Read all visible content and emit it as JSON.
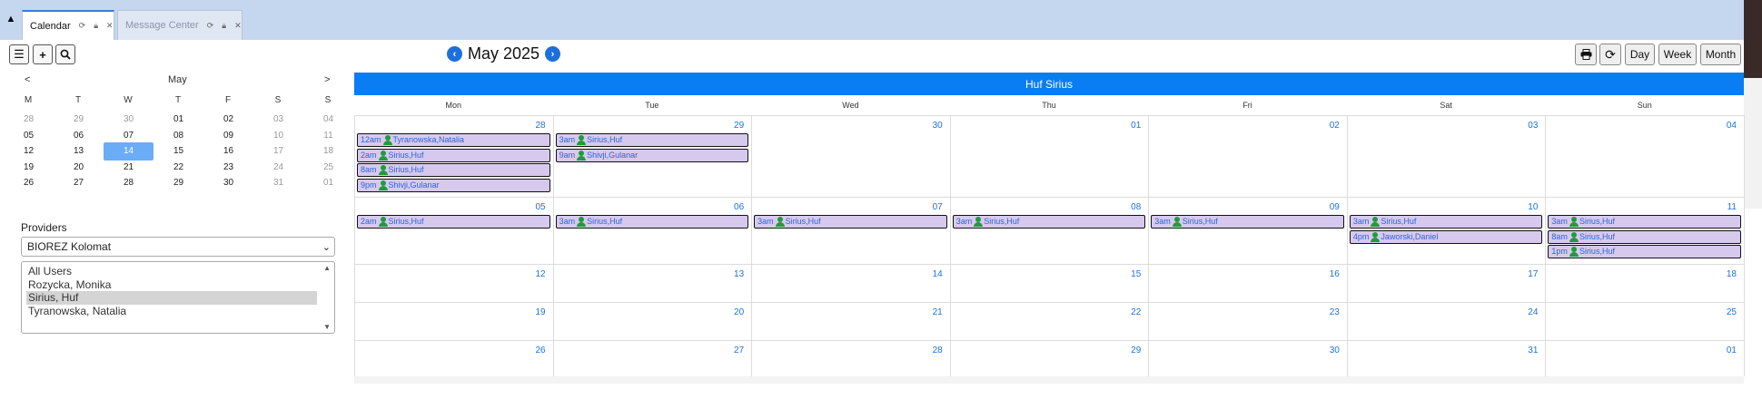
{
  "tabs": [
    {
      "label": "Calendar"
    },
    {
      "label": "Message Center"
    }
  ],
  "toolbar": {
    "menu_icon": "menu-icon",
    "add_icon": "plus-icon",
    "search_icon": "search-icon"
  },
  "mini_calendar": {
    "prev": "<",
    "next": ">",
    "month": "May",
    "weekday_headers": [
      "M",
      "T",
      "W",
      "T",
      "F",
      "S",
      "S"
    ],
    "weeks": [
      [
        "28",
        "29",
        "30",
        "01",
        "02",
        "03",
        "04"
      ],
      [
        "05",
        "06",
        "07",
        "08",
        "09",
        "10",
        "11"
      ],
      [
        "12",
        "13",
        "14",
        "15",
        "16",
        "17",
        "18"
      ],
      [
        "19",
        "20",
        "21",
        "22",
        "23",
        "24",
        "25"
      ],
      [
        "26",
        "27",
        "28",
        "29",
        "30",
        "31",
        "01"
      ]
    ],
    "selected": "14"
  },
  "providers": {
    "label": "Providers",
    "facility_selected": "BIOREZ Kolomat",
    "list": [
      "All Users",
      "Rozycka, Monika",
      "Sirius, Huf",
      "Tyranowska, Natalia"
    ],
    "selected_index": 2
  },
  "header": {
    "title": "May 2025",
    "prev_icon": "chevron-left-icon",
    "next_icon": "chevron-right-icon"
  },
  "view_buttons": {
    "print_icon": "print-icon",
    "refresh_icon": "refresh-icon",
    "day": "Day",
    "week": "Week",
    "month": "Month"
  },
  "calendar": {
    "provider_banner": "Huf Sirius",
    "weekdays": [
      "Mon",
      "Tue",
      "Wed",
      "Thu",
      "Fri",
      "Sat",
      "Sun"
    ],
    "weeks": [
      [
        "28",
        "29",
        "30",
        "01",
        "02",
        "03",
        "04"
      ],
      [
        "05",
        "06",
        "07",
        "08",
        "09",
        "10",
        "11"
      ],
      [
        "12",
        "13",
        "14",
        "15",
        "16",
        "17",
        "18"
      ],
      [
        "19",
        "20",
        "21",
        "22",
        "23",
        "24",
        "25"
      ],
      [
        "26",
        "27",
        "28",
        "29",
        "30",
        "31",
        "01"
      ]
    ],
    "events": [
      {
        "week": 0,
        "day": 0,
        "slot": 0,
        "time": "12am",
        "name": "Tyranowska,Natalia"
      },
      {
        "week": 0,
        "day": 0,
        "slot": 1,
        "time": "2am",
        "name": "Sirius,Huf"
      },
      {
        "week": 0,
        "day": 0,
        "slot": 2,
        "time": "8am",
        "name": "Sirius,Huf"
      },
      {
        "week": 0,
        "day": 0,
        "slot": 3,
        "time": "9pm",
        "name": "Shivji,Gulanar"
      },
      {
        "week": 0,
        "day": 1,
        "slot": 0,
        "time": "3am",
        "name": "Sirius,Huf"
      },
      {
        "week": 0,
        "day": 1,
        "slot": 1,
        "time": "9am",
        "name": "Shivji,Gulanar"
      },
      {
        "week": 1,
        "day": 0,
        "slot": 0,
        "time": "2am",
        "name": "Sirius,Huf"
      },
      {
        "week": 1,
        "day": 1,
        "slot": 0,
        "time": "3am",
        "name": "Sirius,Huf"
      },
      {
        "week": 1,
        "day": 2,
        "slot": 0,
        "time": "3am",
        "name": "Sirius,Huf"
      },
      {
        "week": 1,
        "day": 3,
        "slot": 0,
        "time": "3am",
        "name": "Sirius,Huf"
      },
      {
        "week": 1,
        "day": 4,
        "slot": 0,
        "time": "3am",
        "name": "Sirius,Huf"
      },
      {
        "week": 1,
        "day": 5,
        "slot": 0,
        "time": "3am",
        "name": "Sirius,Huf"
      },
      {
        "week": 1,
        "day": 5,
        "slot": 1,
        "time": "4pm",
        "name": "Jaworski,Daniel"
      },
      {
        "week": 1,
        "day": 6,
        "slot": 0,
        "time": "3am",
        "name": "Sirius,Huf"
      },
      {
        "week": 1,
        "day": 6,
        "slot": 1,
        "time": "8am",
        "name": "Sirius,Huf"
      },
      {
        "week": 1,
        "day": 6,
        "slot": 2,
        "time": "1pm",
        "name": "Sirius,Huf"
      }
    ]
  },
  "colors": {
    "accent": "#0a7df5",
    "event_bg": "#d7c9ee",
    "person_icon": "#1f9c3a",
    "date_link": "#1a73e8",
    "selected_day": "#6aacf5"
  }
}
